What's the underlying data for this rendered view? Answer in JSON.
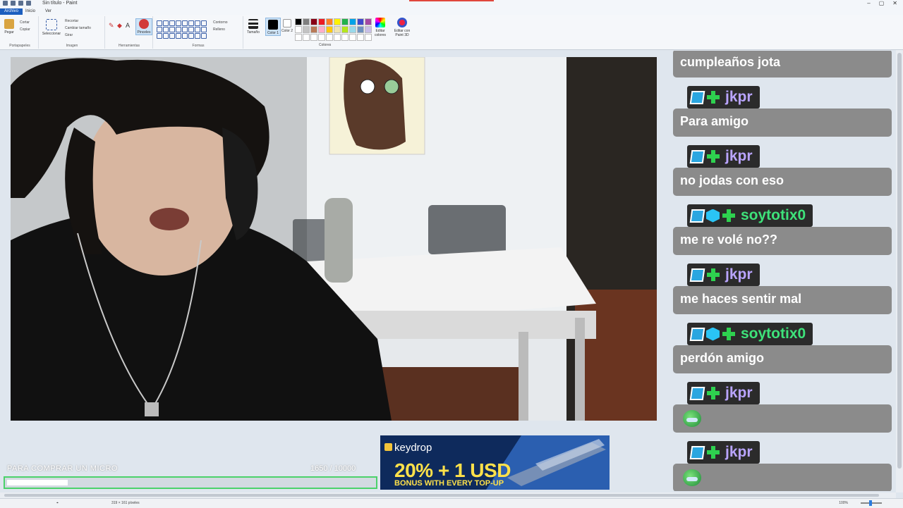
{
  "window": {
    "title": "Sin título - Paint",
    "controls": [
      "–",
      "▢",
      "✕"
    ]
  },
  "ribbon_tabs": [
    "Archivo",
    "Inicio",
    "Ver"
  ],
  "ribbon": {
    "clipboard": {
      "paste": "Pegar",
      "cut": "Cortar",
      "copy": "Copiar",
      "label": "Portapapeles"
    },
    "image": {
      "select": "Seleccionar",
      "crop": "Recortar",
      "resize": "Cambiar tamaño",
      "rotate": "Girar",
      "label": "Imagen"
    },
    "tools": {
      "brushes": "Pinceles",
      "label": "Herramientas"
    },
    "shapes": {
      "outline": "Contorno",
      "fill": "Relleno",
      "label": "Formas"
    },
    "size": "Tamaño",
    "color1": "Color 1",
    "color2": "Color 2",
    "edit_colors": "Editar colores",
    "paint3d": "Editar con Paint 3D",
    "colors_label": "Colores",
    "palette": [
      "#000000",
      "#7f7f7f",
      "#880015",
      "#ed1c24",
      "#ff7f27",
      "#fff200",
      "#22b14c",
      "#00a2e8",
      "#3f48cc",
      "#a349a4",
      "#ffffff",
      "#c3c3c3",
      "#b97a57",
      "#ffaec9",
      "#ffc90e",
      "#efe4b0",
      "#b5e61d",
      "#99d9ea",
      "#7092be",
      "#c8bfe7",
      "#ffffff",
      "#ffffff",
      "#ffffff",
      "#ffffff",
      "#ffffff",
      "#ffffff",
      "#ffffff",
      "#ffffff",
      "#ffffff",
      "#ffffff"
    ]
  },
  "status": {
    "size": "319 × 161 píxeles",
    "zoom": "100%"
  },
  "chat": {
    "colors": {
      "bubble": "#8b8b8b",
      "badge_bg": "#2b2b2b",
      "jkpr": "#b9a4ff",
      "soytotix": "#3ee27a"
    },
    "messages": [
      {
        "user": "",
        "text": "cumpleaños jota",
        "emote": false
      },
      {
        "user": "jkpr",
        "text": "Para amigo",
        "emote": false
      },
      {
        "user": "jkpr",
        "text": "no jodas con eso",
        "emote": false
      },
      {
        "user": "soytotix0",
        "text": "me re volé no??",
        "emote": false
      },
      {
        "user": "jkpr",
        "text": "me haces sentir mal",
        "emote": false
      },
      {
        "user": "soytotix0",
        "text": "perdón amigo",
        "emote": false
      },
      {
        "user": "jkpr",
        "text": "",
        "emote": true
      },
      {
        "user": "jkpr",
        "text": "",
        "emote": true
      }
    ]
  },
  "goal": {
    "label": "PARA COMPRAR UN MICRO",
    "current": 1650,
    "target": 10000,
    "count_text": "1650 / 10000"
  },
  "ad": {
    "brand": "keydrop",
    "headline": "20% + 1 USD",
    "sub": "BONUS WITH EVERY TOP-UP"
  }
}
